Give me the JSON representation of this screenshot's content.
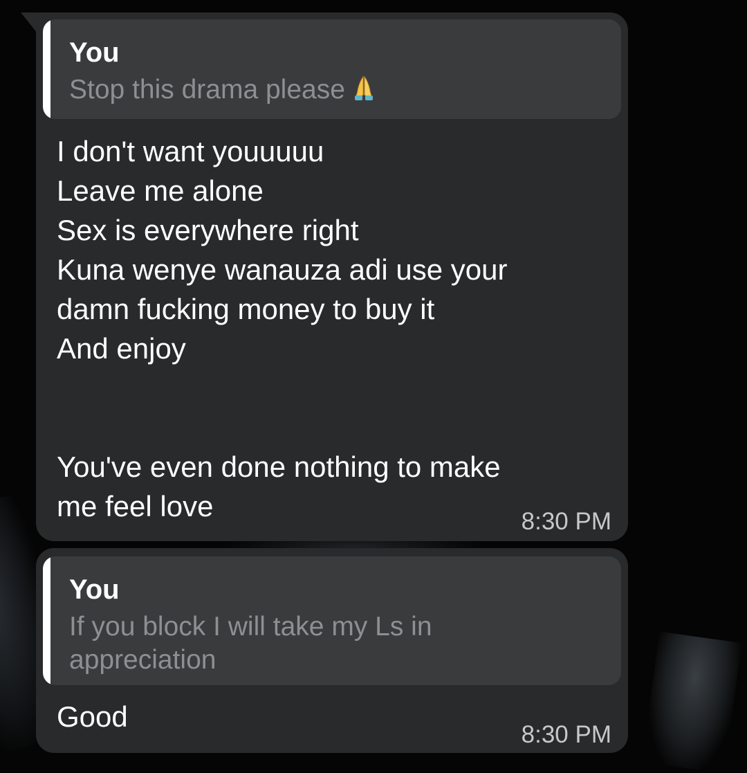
{
  "messages": [
    {
      "reply_to": {
        "author": "You",
        "text": "Stop this drama please",
        "emoji": "folded-hands-icon"
      },
      "text": "I don't want youuuuu\nLeave me alone\nSex is everywhere right\nKuna wenye wanauza adi use your\ndamn fucking money to buy it\nAnd enjoy\n\n\nYou've even done nothing to make\nme feel love",
      "time": "8:30 PM"
    },
    {
      "reply_to": {
        "author": "You",
        "text": "If you block I will take my Ls in\nappreciation"
      },
      "text": "Good",
      "time": "8:30 PM"
    }
  ],
  "colors": {
    "background": "#050505",
    "bubble": "#282a2c",
    "quote_background": "#3a3b3d",
    "quote_bar": "#ffffff",
    "quote_text": "#8e8f92",
    "message_text": "#ffffff",
    "timestamp": "#c7c8ca"
  }
}
